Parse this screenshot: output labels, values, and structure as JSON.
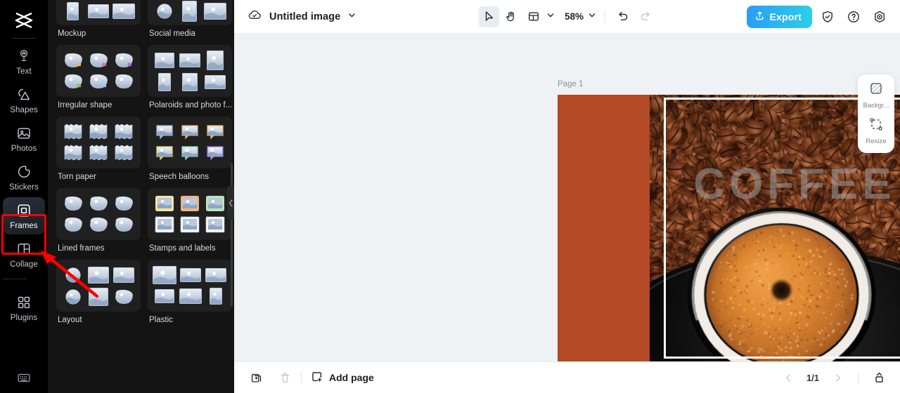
{
  "app": {
    "brand_icon": "capcut-logo-icon",
    "accent": "#2ab4e8",
    "rail_bg": "#000000",
    "panel_bg": "#141414",
    "canvas_bg": "#eef2f5",
    "artboard_bg": "#b44a25",
    "annotation_color": "#ff0000"
  },
  "sidebar": {
    "items": [
      {
        "label": "Text",
        "icon": "text-icon",
        "active": false
      },
      {
        "label": "Shapes",
        "icon": "shapes-icon",
        "active": false
      },
      {
        "label": "Photos",
        "icon": "photos-icon",
        "active": false
      },
      {
        "label": "Stickers",
        "icon": "stickers-icon",
        "active": false
      },
      {
        "label": "Frames",
        "icon": "frames-icon",
        "active": true
      },
      {
        "label": "Collage",
        "icon": "collage-icon",
        "active": false
      },
      {
        "label": "Plugins",
        "icon": "plugins-icon",
        "active": false
      }
    ],
    "keyboard_icon": "keyboard-icon"
  },
  "frames_panel": {
    "categories": [
      {
        "name": "Mockup",
        "kind": "mockup"
      },
      {
        "name": "Social media",
        "kind": "social"
      },
      {
        "name": "Irregular shape",
        "kind": "irregular"
      },
      {
        "name": "Polaroids and photo f...",
        "kind": "polaroid"
      },
      {
        "name": "Torn paper",
        "kind": "torn"
      },
      {
        "name": "Speech balloons",
        "kind": "balloon"
      },
      {
        "name": "Lined frames",
        "kind": "lined"
      },
      {
        "name": "Stamps and labels",
        "kind": "stamps"
      },
      {
        "name": "Layout",
        "kind": "layout"
      },
      {
        "name": "Plastic",
        "kind": "plastic"
      }
    ],
    "collapse_icon": "chevron-left-icon"
  },
  "toolbar": {
    "cloud_icon": "cloud-saved-icon",
    "doc_title": "Untitled image",
    "title_chevron": "chevron-down-icon",
    "select_tool_icon": "cursor-arrow-icon",
    "hand_tool_icon": "hand-icon",
    "layout_tool_icon": "layout-panels-icon",
    "layout_chevron": "chevron-down-icon",
    "zoom_level": "58%",
    "zoom_chevron": "chevron-down-icon",
    "undo_icon": "undo-icon",
    "redo_icon": "redo-icon",
    "export_label": "Export",
    "export_icon": "upload-icon",
    "shield_icon": "shield-check-icon",
    "help_icon": "question-circle-icon",
    "settings_icon": "settings-gear-icon"
  },
  "canvas": {
    "page_label": "Page 1",
    "duplicate_page_icon": "duplicate-page-icon",
    "more_options_icon": "more-horizontal-icon",
    "artboard_text": "COFFEE",
    "selection_frame": "frame-selection-border"
  },
  "right_dock": {
    "items": [
      {
        "label": "Backgr...",
        "icon": "background-icon"
      },
      {
        "label": "Resize",
        "icon": "resize-icon"
      }
    ]
  },
  "bottombar": {
    "duplicate_icon": "duplicate-icon",
    "delete_icon": "trash-icon",
    "add_page_label": "Add page",
    "add_page_icon": "add-page-icon",
    "prev_icon": "chevron-left-icon",
    "page_indicator": "1/1",
    "next_icon": "chevron-right-icon",
    "export_page_icon": "export-page-icon"
  }
}
